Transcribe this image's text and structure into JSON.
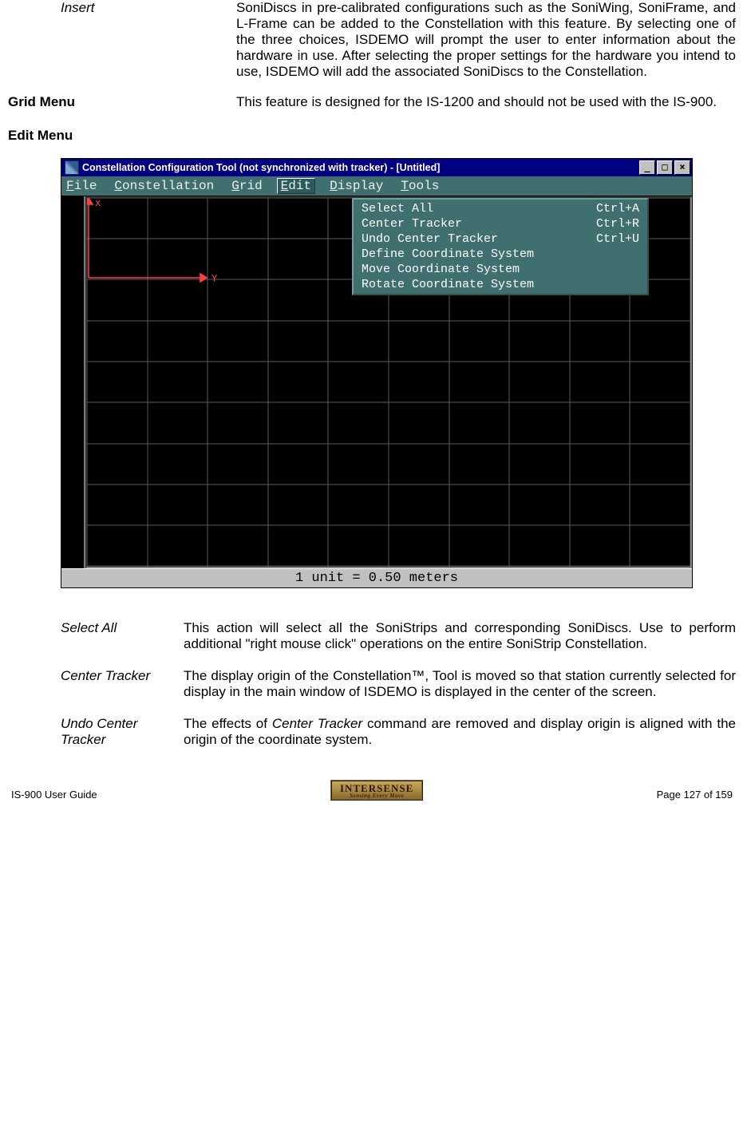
{
  "top_defs": [
    {
      "term": "Insert",
      "class": "",
      "desc": "SoniDiscs in pre-calibrated configurations such as the SoniWing, SoniFrame, and L-Frame can be added to the Constellation with this feature.  By selecting one of the three choices, ISDEMO will prompt the user to enter information about the hardware in use.  After selecting the proper settings for the hardware you intend to use, ISDEMO will add the associated SoniDiscs to the Constellation."
    },
    {
      "term": "Grid Menu",
      "class": "bold",
      "desc": "This feature is designed for the IS-1200 and should not be used with the IS-900."
    }
  ],
  "section_head": "Edit Menu",
  "window": {
    "title": "Constellation Configuration Tool (not synchronized with tracker) - [Untitled]",
    "menu": [
      "File",
      "Constellation",
      "Grid",
      "Edit",
      "Display",
      "Tools"
    ],
    "active_menu_index": 3,
    "dropdown": [
      {
        "label": "Select All",
        "accel": "Ctrl+A"
      },
      {
        "label": "Center Tracker",
        "accel": "Ctrl+R"
      },
      {
        "label": "Undo Center Tracker",
        "accel": "Ctrl+U"
      },
      {
        "label": "Define Coordinate System",
        "accel": ""
      },
      {
        "label": "Move Coordinate System",
        "accel": ""
      },
      {
        "label": "Rotate Coordinate System",
        "accel": ""
      }
    ],
    "axis_x_label": "x",
    "axis_y_label": "Y",
    "status": "1 unit =   0.50 meters"
  },
  "bottom_defs": [
    {
      "term": "Select All",
      "desc": "This action will select all the SoniStrips and corresponding SoniDiscs.   Use to perform additional \"right mouse click\" operations on the entire SoniStrip Constellation."
    },
    {
      "term": "Center Tracker",
      "desc": "The display origin of the Constellation™, Tool is moved so that station currently selected for display in the main window of ISDEMO is displayed in the center of the screen."
    },
    {
      "term": "Undo Center Tracker",
      "desc": "The effects of Center Tracker command are removed and display origin is aligned with the origin of the coordinate system."
    }
  ],
  "footer": {
    "left": "IS-900 User Guide",
    "right": "Page 127 of 159",
    "logo_top": "INTERSENSE",
    "logo_bottom": "Sensing Every Move"
  }
}
